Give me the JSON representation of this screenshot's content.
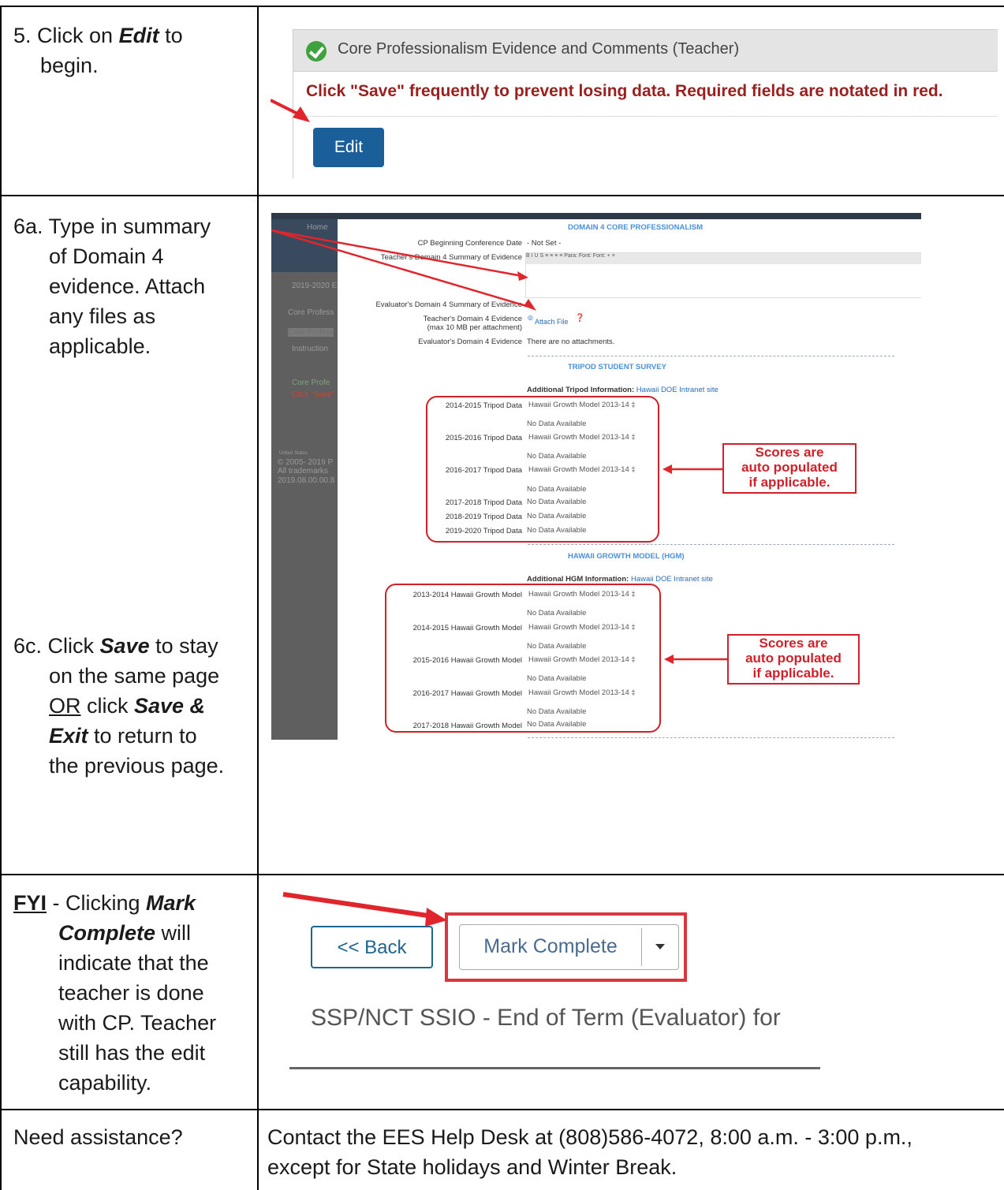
{
  "rows": {
    "r1": {
      "label_prefix": "5. Click on ",
      "label_bold": "Edit",
      "label_suffix": " to",
      "label_line2": "begin."
    },
    "r2": {
      "label_a_lines": [
        "6a. Type in summary",
        "of Domain 4",
        "evidence. Attach",
        "any files as",
        "applicable."
      ],
      "label_c_prefix": "6c. Click ",
      "label_c_save": "Save",
      "label_c_suffix": " to stay",
      "label_c_line2": "on the same page",
      "label_c_or": "OR",
      "label_c_click": " click ",
      "label_c_saveexit1": "Save &",
      "label_c_exit": "Exit",
      "label_c_return": " to return to",
      "label_c_last": "the previous page."
    },
    "r3": {
      "fyi": "FYI",
      "prefix": " - Clicking ",
      "mark": "Mark",
      "complete": "Complete",
      "will": " will",
      "lines": [
        "indicate that the",
        "teacher is done",
        "with CP. Teacher",
        "still has the edit",
        "capability."
      ]
    },
    "r4": {
      "label": "Need assistance?",
      "line1": "Contact the EES Help Desk at (808)586-4072, 8:00 a.m. - 3:00 p.m.,",
      "line2": "except for State holidays and Winter Break."
    }
  },
  "shot1": {
    "title": "Core Professionalism Evidence and Comments (Teacher)",
    "warning": "Click \"Save\" frequently to prevent losing data. Required fields are notated in red.",
    "edit_button": "Edit",
    "status_icon": "check-circle-icon"
  },
  "shot2": {
    "side": [
      "Home",
      "2019-2020 E",
      "Core Profess",
      "Core Profess",
      "Instruction",
      "Core Profe",
      "Click \"Save\"",
      "United States",
      "© 2005- 2019 P",
      "All trademarks",
      "2019.08.00.00.8"
    ],
    "section1": "DOMAIN 4 CORE PROFESSIONALISM",
    "cp_date_label": "CP Beginning Conference Date",
    "cp_date_value": "- Not Set -",
    "teacher_summary_label": "Teacher's Domain 4 Summary of Evidence",
    "editor_toolbar": "B I U S ≡ ≡ ≡ ≡ Para: Font: Font: + ×",
    "evaluator_summary_label": "Evaluator's Domain 4 Summary of Evidence",
    "teacher_evidence_label": "Teacher's Domain 4 Evidence",
    "teacher_evidence_sub": "(max 10 MB per attachment)",
    "attach_file": "Attach File",
    "evaluator_evidence_label": "Evaluator's Domain 4 Evidence",
    "evaluator_evidence_value": "There are no attachments.",
    "section2": "TRIPOD STUDENT SURVEY",
    "tripod_info_label": "Additional Tripod Information:",
    "tripod_info_link": "Hawaii DOE Intranet site",
    "tripod_rows": [
      {
        "label": "2014-2015 Tripod Data",
        "value": "Hawaii Growth Model 2013-14 ‡",
        "sub": "No Data Available"
      },
      {
        "label": "2015-2016 Tripod Data",
        "value": "Hawaii Growth Model 2013-14 ‡",
        "sub": "No Data Available"
      },
      {
        "label": "2016-2017 Tripod Data",
        "value": "Hawaii Growth Model 2013-14 ‡",
        "sub": "No Data Available"
      },
      {
        "label": "2017-2018 Tripod Data",
        "value": "No Data Available"
      },
      {
        "label": "2018-2019 Tripod Data",
        "value": "No Data Available"
      },
      {
        "label": "2019-2020 Tripod Data",
        "value": "No Data Available"
      }
    ],
    "section3": "HAWAII GROWTH MODEL (HGM)",
    "hgm_info_label": "Additional HGM Information:",
    "hgm_info_link": "Hawaii DOE Intranet site",
    "hgm_rows": [
      {
        "label": "2013-2014 Hawaii Growth Model",
        "value": "Hawaii Growth Model 2013-14 ‡",
        "sub": "No Data Available"
      },
      {
        "label": "2014-2015 Hawaii Growth Model",
        "value": "Hawaii Growth Model 2013-14 ‡",
        "sub": "No Data Available"
      },
      {
        "label": "2015-2016 Hawaii Growth Model",
        "value": "Hawaii Growth Model 2013-14 ‡",
        "sub": "No Data Available"
      },
      {
        "label": "2016-2017 Hawaii Growth Model",
        "value": "Hawaii Growth Model 2013-14 ‡",
        "sub": "No Data Available"
      },
      {
        "label": "2017-2018 Hawaii Growth Model",
        "value": "No Data Available"
      }
    ],
    "callout_lines": [
      "Scores are",
      "auto populated",
      "if applicable."
    ]
  },
  "shot3": {
    "back_button": "<< Back",
    "mark_complete": "Mark Complete",
    "heading": "SSP/NCT SSIO - End of Term (Evaluator) for"
  },
  "colors": {
    "red": "#d0202a",
    "edit_blue": "#1a5e9a",
    "link_blue": "#2a6db5"
  }
}
